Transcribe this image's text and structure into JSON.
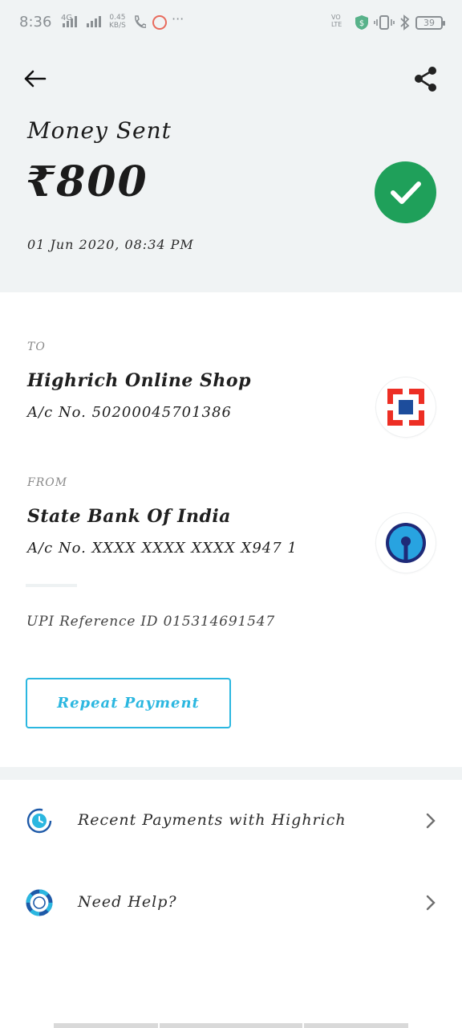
{
  "status_bar": {
    "time": "8:36",
    "network": "4G",
    "speed_value": "0.45",
    "speed_unit": "KB/S",
    "volte": "VO LTE",
    "battery": "39"
  },
  "header": {
    "title": "Money Sent",
    "amount": "₹800",
    "datetime": "01 Jun 2020, 08:34 PM",
    "status_color": "#1fa05a"
  },
  "to": {
    "label": "TO",
    "name": "Highrich Online Shop",
    "account": "A/c No. 50200045701386",
    "logo_icon": "hdfc-bank-logo",
    "logo_color": "#ed2e24"
  },
  "from": {
    "label": "FROM",
    "name": "State Bank Of India",
    "account": "A/c No. XXXX XXXX XXXX X947 1",
    "logo_icon": "sbi-bank-logo",
    "logo_color": "#1f5fae"
  },
  "upi_reference": "UPI Reference ID 015314691547",
  "repeat_button": "Repeat Payment",
  "accent_color": "#2bb7e0",
  "menu": [
    {
      "label": "Recent Payments with Highrich",
      "icon": "clock-refresh-icon"
    },
    {
      "label": "Need Help?",
      "icon": "lifebuoy-icon"
    }
  ]
}
